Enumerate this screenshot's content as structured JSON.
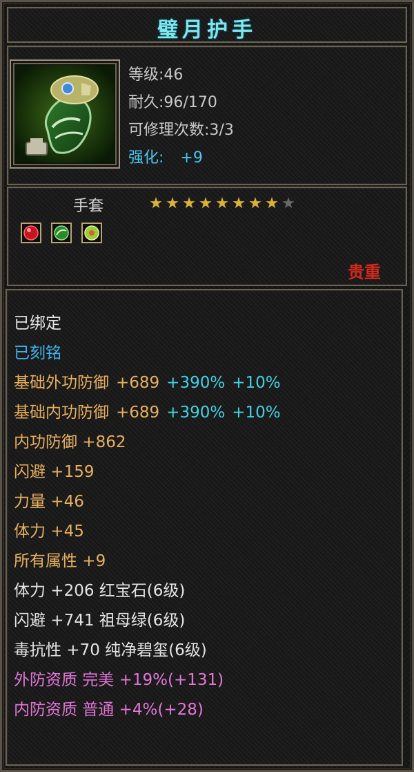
{
  "item": {
    "name": "璧月护手",
    "type": "手套",
    "rarity": "贵重",
    "icon": "green-gauntlet-icon"
  },
  "stats": {
    "level": "等级:46",
    "durability": "耐久:96/170",
    "repair": "可修理次数:3/3",
    "enhance_label": "强化:",
    "enhance_value": "+9"
  },
  "stars": {
    "filled": 8,
    "total": 9
  },
  "gem_slots": [
    {
      "icon": "red-gem-icon",
      "color": "#c8141e"
    },
    {
      "icon": "green-gem-icon",
      "color": "#2a8a2a"
    },
    {
      "icon": "jade-gem-icon",
      "color": "#9acb3a"
    }
  ],
  "colors": {
    "title": "#7fe6ef",
    "enhance": "#49c8f0",
    "rarity": "#d62a1d",
    "bound": "#e4e4e4",
    "engraved": "#3fb4ee",
    "base_attr": "#e8b060",
    "bonus": "#42d2e4",
    "gem_attr": "#e4e4e4",
    "quality": "#e476d8"
  },
  "attributes": {
    "bound": "已绑定",
    "engraved": "已刻铭",
    "ext_def": {
      "label": "基础外功防御",
      "value": "+689",
      "bonus1": "+390%",
      "bonus2": "+10%"
    },
    "int_def": {
      "label": "基础内功防御",
      "value": "+689",
      "bonus1": "+390%",
      "bonus2": "+10%"
    },
    "magic_def": "内功防御 +862",
    "dodge": "闪避  +159",
    "strength": "力量  +46",
    "stamina": "体力  +45",
    "all_attr": "所有属性 +9",
    "gem1": "体力  +206 红宝石(6级)",
    "gem2": "闪避  +741 祖母绿(6级)",
    "gem3": "毒抗性 +70 纯净碧玺(6级)",
    "quality1": "外防资质  完美 +19%(+131)",
    "quality2": "内防资质  普通 +4%(+28)"
  }
}
